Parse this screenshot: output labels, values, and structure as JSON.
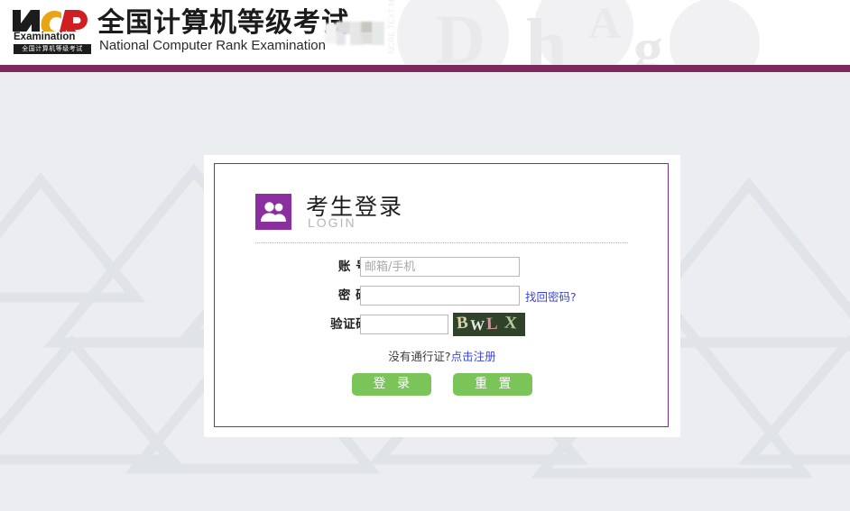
{
  "page": {
    "background_color": "#ecedf1",
    "accent_purple": "#7c2a5d",
    "accent_violet": "#8a2ea0",
    "button_green": "#7ac459",
    "link_blue": "#3b46d6"
  },
  "header": {
    "logo": {
      "mark_text": "NCR",
      "mark_label": "Examination",
      "sub_bar_text": "全国计算机等级考试"
    },
    "title_cn": "全国计算机等级考试",
    "title_en": "National Computer Rank Examination",
    "redaction_label": "redacted-block",
    "watermark_letters": [
      "A",
      "g",
      "h",
      "D"
    ]
  },
  "login": {
    "heading": {
      "title": "考生登录",
      "subtitle": "LOGIN",
      "icon": "users-icon"
    },
    "fields": [
      {
        "key": "account",
        "label": "账 号:",
        "value": "",
        "placeholder": "邮箱/手机"
      },
      {
        "key": "password",
        "label": "密 码:",
        "value": "",
        "placeholder": ""
      },
      {
        "key": "captcha",
        "label": "验证码:",
        "value": "",
        "placeholder": ""
      }
    ],
    "forgot_password_link": "找回密码?",
    "captcha": {
      "text": "BWLX",
      "background_color": "#2e4329",
      "characters": [
        {
          "char": "B",
          "color": "#d6d2a8"
        },
        {
          "char": "W",
          "color": "#e8e8e8"
        },
        {
          "char": "L",
          "color": "#e08f9e"
        },
        {
          "char": "X",
          "color": "#b9c9a0"
        }
      ]
    },
    "register_prompt": "没有通行证?",
    "register_link": "点击注册",
    "buttons": {
      "submit": "登 录",
      "reset": "重 置"
    }
  }
}
